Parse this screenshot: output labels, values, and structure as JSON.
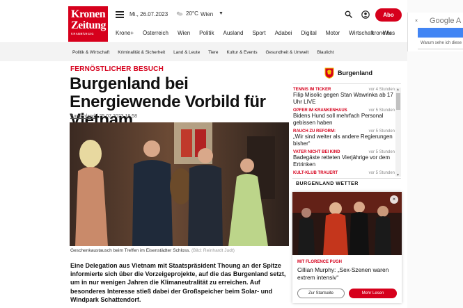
{
  "header": {
    "logo_line1": "Kronen",
    "logo_line2": "Zeitung",
    "logo_tagline": "UNABHÄNGIG",
    "date": "Mi., 26.07.2023",
    "temperature": "20°C",
    "city": "Wien",
    "abo_label": "Abo"
  },
  "main_nav": [
    "Krone+",
    "Österreich",
    "Wien",
    "Politik",
    "Ausland",
    "Sport",
    "Adabei",
    "Digital",
    "Motor",
    "Wirtschaft",
    "Wiss"
  ],
  "main_nav_last": "krone.tv",
  "sub_nav": [
    "Politik & Wirtschaft",
    "Kriminalität & Sicherheit",
    "Land & Leute",
    "Tiere",
    "Kultur & Events",
    "Gesundheit & Umwelt",
    "Blaulicht"
  ],
  "article": {
    "kicker": "FERNÖSTLICHER BESUCH",
    "headline": "Burgenland bei Energiewende Vorbild für Vietnam",
    "byline_region": "Burgenland",
    "byline_sep": " | ",
    "byline_date": "25.07.2023 18:58",
    "caption": "Geschenkaustausch beim Treffen im Eisenstädter Schloss.",
    "caption_credit": "(Bild: Reinhardt Judt)",
    "lead": "Eine Delegation aus Vietnam mit Staatspräsident Thoung an der Spitze informierte sich über die Vorzeigeprojekte, auf die das Burgenland setzt, um in nur wenigen Jahren die Klimaneutralität zu erreichen. Auf besonderes Interesse stieß dabei der Großspeicher beim Solar- und Windpark Schattendorf."
  },
  "sidebar": {
    "region_title": "Burgenland",
    "ticker": [
      {
        "category": "TENNIS IM TICKER",
        "ago": "vor 4 Stunden",
        "title": "Filip Misolic gegen Stan Wawrinka ab 17 Uhr LIVE"
      },
      {
        "category": "OPFER IM KRANKENHAUS",
        "ago": "vor 5 Stunden",
        "title": "Bidens Hund soll mehrfach Personal gebissen haben"
      },
      {
        "category": "RAUCH ZU REFORM:",
        "ago": "vor 5 Stunden",
        "title": "„Wir sind weiter als andere Regierungen bisher“"
      },
      {
        "category": "VATER NICHT BEI KIND",
        "ago": "vor 5 Stunden",
        "title": "Badegäste retteten Vierjährige vor dem Ertrinken"
      },
      {
        "category": "KULT-KLUB TRAUERT",
        "ago": "vor 5 Stunden",
        "title": ""
      }
    ],
    "weather_title": "BURGENLAND WETTER"
  },
  "popup": {
    "kicker": "MIT FLORENCE PUGH",
    "title": "Cillian Murphy: „Sex-Szenen waren extrem intensiv“",
    "btn_start": "Zur Startseite",
    "btn_more": "Mehr Lesen",
    "close": "×"
  },
  "translate": {
    "brand": "Google A",
    "close": "×",
    "text": "Warum sehe ich diese"
  },
  "colors": {
    "brand_red": "#d6001c",
    "google_blue": "#4285f4"
  }
}
